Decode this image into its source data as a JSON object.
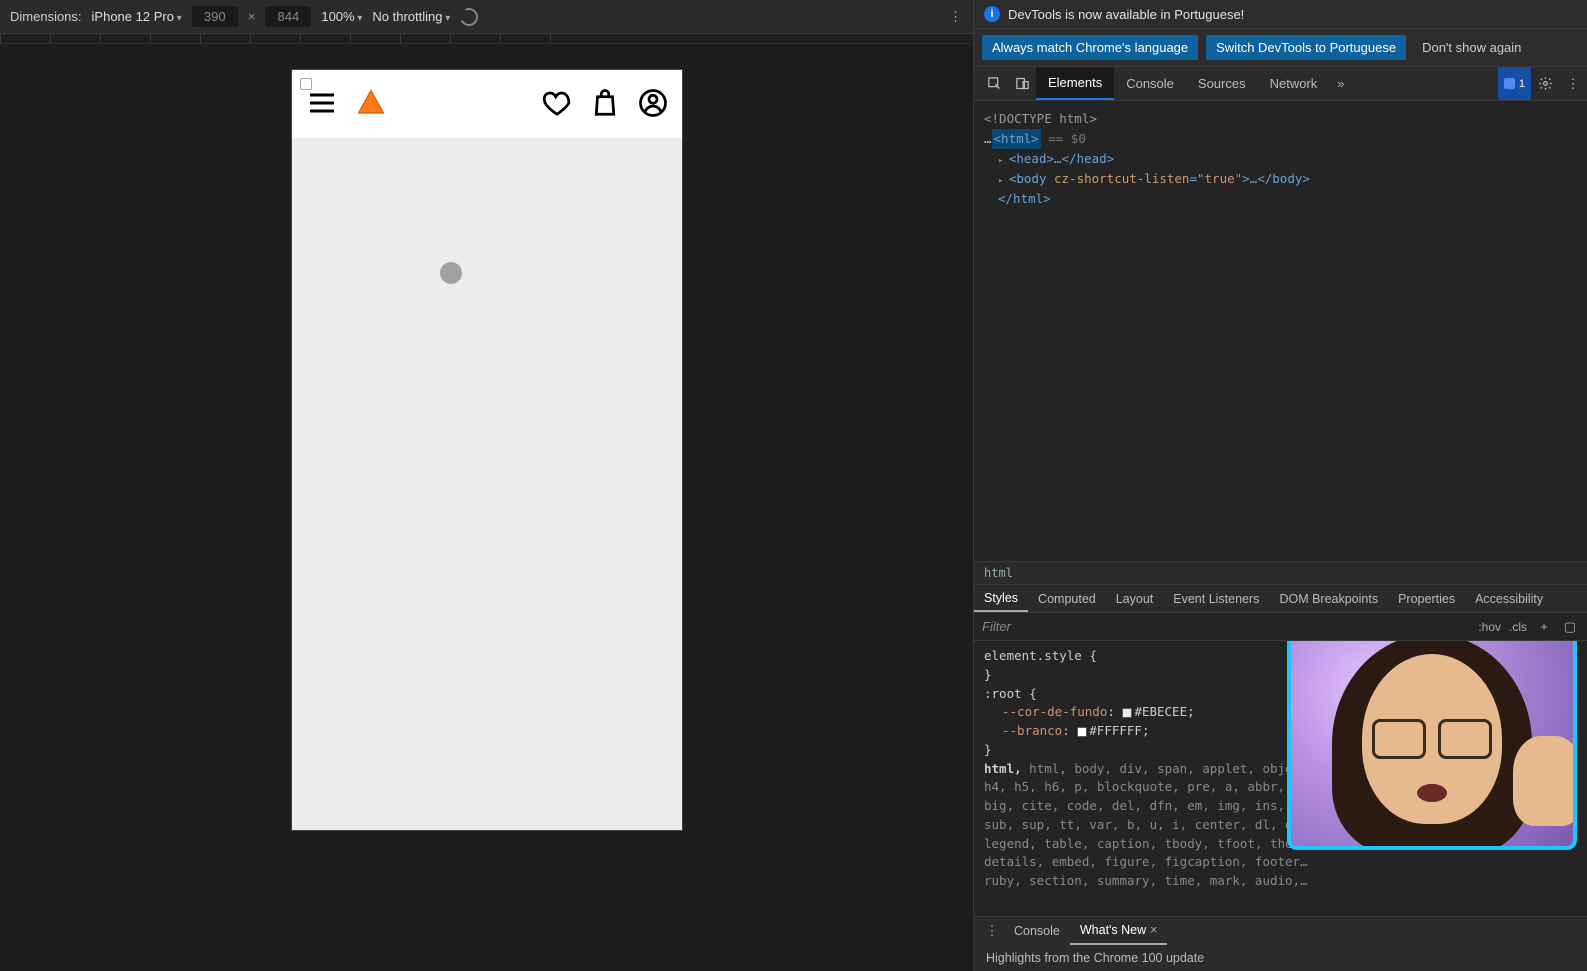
{
  "device_toolbar": {
    "dimensions_label": "Dimensions:",
    "device_name": "iPhone 12 Pro",
    "width": "390",
    "height": "844",
    "zoom": "100%",
    "throttling": "No throttling"
  },
  "infobar": {
    "message": "DevTools is now available in Portuguese!",
    "btn_always": "Always match Chrome's language",
    "btn_switch": "Switch DevTools to Portuguese",
    "btn_dismiss": "Don't show again"
  },
  "tabs": {
    "elements": "Elements",
    "console": "Console",
    "sources": "Sources",
    "network": "Network",
    "more": "»",
    "issues_count": "1"
  },
  "dom": {
    "doctype": "<!DOCTYPE html>",
    "html_open": "<html>",
    "selection_marker": "== $0",
    "head": "<head>…</head>",
    "body_open": "<body ",
    "body_attr_name": "cz-shortcut-listen",
    "body_attr_eq": "=\"",
    "body_attr_val": "true",
    "body_attr_close": "\">",
    "body_ellipsis": "…",
    "body_close": "</body>",
    "html_close": "</html>"
  },
  "crumb": "html",
  "subtabs": {
    "styles": "Styles",
    "computed": "Computed",
    "layout": "Layout",
    "event_listeners": "Event Listeners",
    "dom_breakpoints": "DOM Breakpoints",
    "properties": "Properties",
    "accessibility": "Accessibility"
  },
  "filter": {
    "placeholder": "Filter",
    "hov": ":hov",
    "cls": ".cls"
  },
  "styles": {
    "element_style": "element.style {",
    "close": "}",
    "root_sel": ":root {",
    "var1_name": "--cor-de-fundo",
    "var1_val": "#EBECEE",
    "var2_name": "--branco",
    "var2_val": "#FFFFFF",
    "reset_sel": "html, body, div, span, applet, object, ifr…",
    "reset_l2": "h4, h5, h6, p, blockquote, pre, a, abbr, a…",
    "reset_l3": "big, cite, code, del, dfn, em, img, ins, k…",
    "reset_l4": "sub, sup, tt, var, b, u, i, center, dl, dt…",
    "reset_l5": "legend, table, caption, tbody, tfoot, thea…",
    "reset_l6": "details, embed, figure, figcaption, footer…",
    "reset_l7": "ruby, section, summary, time, mark, audio,…"
  },
  "drawer": {
    "console": "Console",
    "whats_new": "What's New",
    "close_x": "×",
    "highlight": "Highlights from the Chrome 100 update"
  }
}
